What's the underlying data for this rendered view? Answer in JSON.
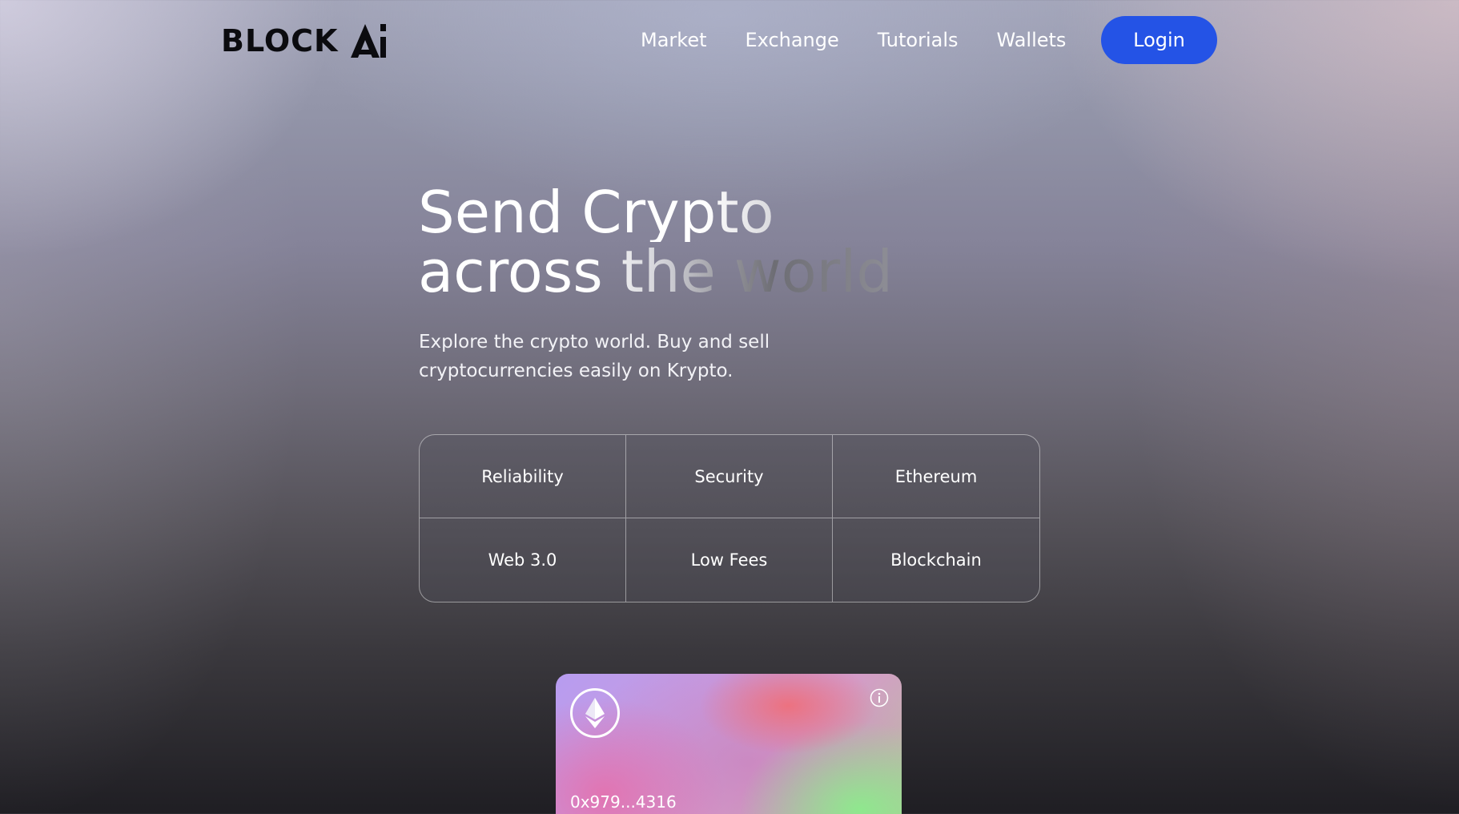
{
  "brand": {
    "logo_text": "BLOCK",
    "logo_mark_text": "Ai"
  },
  "nav": {
    "items": [
      {
        "label": "Market"
      },
      {
        "label": "Exchange"
      },
      {
        "label": "Tutorials"
      },
      {
        "label": "Wallets"
      }
    ],
    "login_label": "Login"
  },
  "hero": {
    "title_line1": "Send Crypto",
    "title_line2": "across the world",
    "subtitle": "Explore the crypto world. Buy and sell cryptocurrencies easily on Krypto."
  },
  "features": [
    {
      "label": "Reliability"
    },
    {
      "label": "Security"
    },
    {
      "label": "Ethereum"
    },
    {
      "label": "Web 3.0"
    },
    {
      "label": "Low Fees"
    },
    {
      "label": "Blockchain"
    }
  ],
  "card": {
    "address": "0x979...4316",
    "coin_icon": "ethereum-icon",
    "info_icon": "info-icon"
  },
  "colors": {
    "accent": "#2453e6",
    "text": "#ffffff"
  }
}
